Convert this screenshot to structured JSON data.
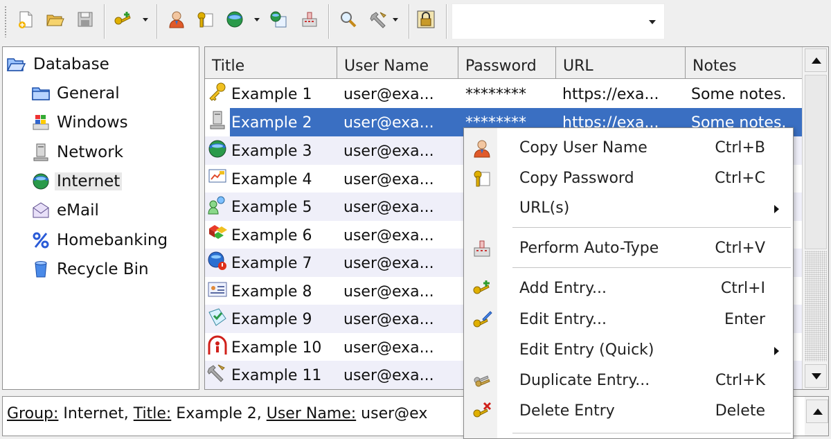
{
  "toolbar": {
    "buttons": [
      {
        "name": "new-database-icon"
      },
      {
        "name": "open-database-icon"
      },
      {
        "name": "save-database-icon"
      },
      {
        "name": "add-entry-icon",
        "dropdown": true
      },
      {
        "name": "copy-username-icon"
      },
      {
        "name": "copy-password-icon"
      },
      {
        "name": "open-url-icon",
        "dropdown": true
      },
      {
        "name": "copy-url-icon"
      },
      {
        "name": "auto-type-icon"
      },
      {
        "name": "find-icon"
      },
      {
        "name": "tools-icon",
        "dropdown": true
      },
      {
        "name": "lock-workspace-icon"
      }
    ],
    "quickfind_value": ""
  },
  "tree": {
    "items": [
      {
        "label": "Database",
        "icon": "folder-open-icon",
        "selected": false
      },
      {
        "label": "General",
        "icon": "folder-icon",
        "selected": false
      },
      {
        "label": "Windows",
        "icon": "windows-icon",
        "selected": false
      },
      {
        "label": "Network",
        "icon": "network-icon",
        "selected": false
      },
      {
        "label": "Internet",
        "icon": "globe-icon",
        "selected": true
      },
      {
        "label": "eMail",
        "icon": "email-icon",
        "selected": false
      },
      {
        "label": "Homebanking",
        "icon": "percent-icon",
        "selected": false
      },
      {
        "label": "Recycle Bin",
        "icon": "recycle-bin-icon",
        "selected": false
      }
    ]
  },
  "list": {
    "columns": [
      "Title",
      "User Name",
      "Password",
      "URL",
      "Notes"
    ],
    "rows": [
      {
        "title": "Example 1",
        "user": "user@exa...",
        "password": "********",
        "url": "https://exa...",
        "notes": "Some notes.",
        "icon": "key-icon"
      },
      {
        "title": "Example 2",
        "user": "user@exa...",
        "password": "********",
        "url": "https://exa...",
        "notes": "Some notes.",
        "icon": "computer-icon"
      },
      {
        "title": "Example 3",
        "user": "user@exa...",
        "password": "",
        "url": "",
        "notes": "",
        "icon": "globe-icon"
      },
      {
        "title": "Example 4",
        "user": "user@exa...",
        "password": "",
        "url": "",
        "notes": "",
        "icon": "presentation-icon"
      },
      {
        "title": "Example 5",
        "user": "user@exa...",
        "password": "",
        "url": "",
        "notes": "",
        "icon": "users-icon"
      },
      {
        "title": "Example 6",
        "user": "user@exa...",
        "password": "",
        "url": "",
        "notes": "",
        "icon": "blocks-icon"
      },
      {
        "title": "Example 7",
        "user": "user@exa...",
        "password": "",
        "url": "",
        "notes": "",
        "icon": "globe-warning-icon"
      },
      {
        "title": "Example 8",
        "user": "user@exa...",
        "password": "",
        "url": "",
        "notes": "",
        "icon": "id-card-icon"
      },
      {
        "title": "Example 9",
        "user": "user@exa...",
        "password": "",
        "url": "",
        "notes": "",
        "icon": "sticker-icon"
      },
      {
        "title": "Example 10",
        "user": "user@exa...",
        "password": "",
        "url": "",
        "notes": "",
        "icon": "info-icon"
      },
      {
        "title": "Example 11",
        "user": "user@exa...",
        "password": "",
        "url": "",
        "notes": "",
        "icon": "tools-icon"
      }
    ]
  },
  "details": {
    "group_label": "Group:",
    "group_value": " Internet, ",
    "title_label": "Title:",
    "title_value": " Example 2, ",
    "user_label": "User Name:",
    "user_value": " user@ex"
  },
  "context_menu": {
    "items": [
      {
        "label": "Copy User Name",
        "shortcut": "Ctrl+B",
        "icon": "copy-username-icon",
        "submenu": false
      },
      {
        "label": "Copy Password",
        "shortcut": "Ctrl+C",
        "icon": "copy-password-icon",
        "submenu": false
      },
      {
        "label": "URL(s)",
        "shortcut": "",
        "icon": "",
        "submenu": true
      },
      {
        "label": "Perform Auto-Type",
        "shortcut": "Ctrl+V",
        "icon": "auto-type-icon",
        "submenu": false
      },
      {
        "label": "Add Entry...",
        "shortcut": "Ctrl+I",
        "icon": "add-entry-icon",
        "submenu": false
      },
      {
        "label": "Edit Entry...",
        "shortcut": "Enter",
        "icon": "edit-entry-icon",
        "submenu": false
      },
      {
        "label": "Edit Entry (Quick)",
        "shortcut": "",
        "icon": "",
        "submenu": true
      },
      {
        "label": "Duplicate Entry...",
        "shortcut": "Ctrl+K",
        "icon": "duplicate-entry-icon",
        "submenu": false
      },
      {
        "label": "Delete Entry",
        "shortcut": "Delete",
        "icon": "delete-entry-icon",
        "submenu": false
      }
    ]
  },
  "colors": {
    "selection": "#3a6fc2",
    "alt_row": "#efeff9",
    "link": "#2a5bd7"
  }
}
